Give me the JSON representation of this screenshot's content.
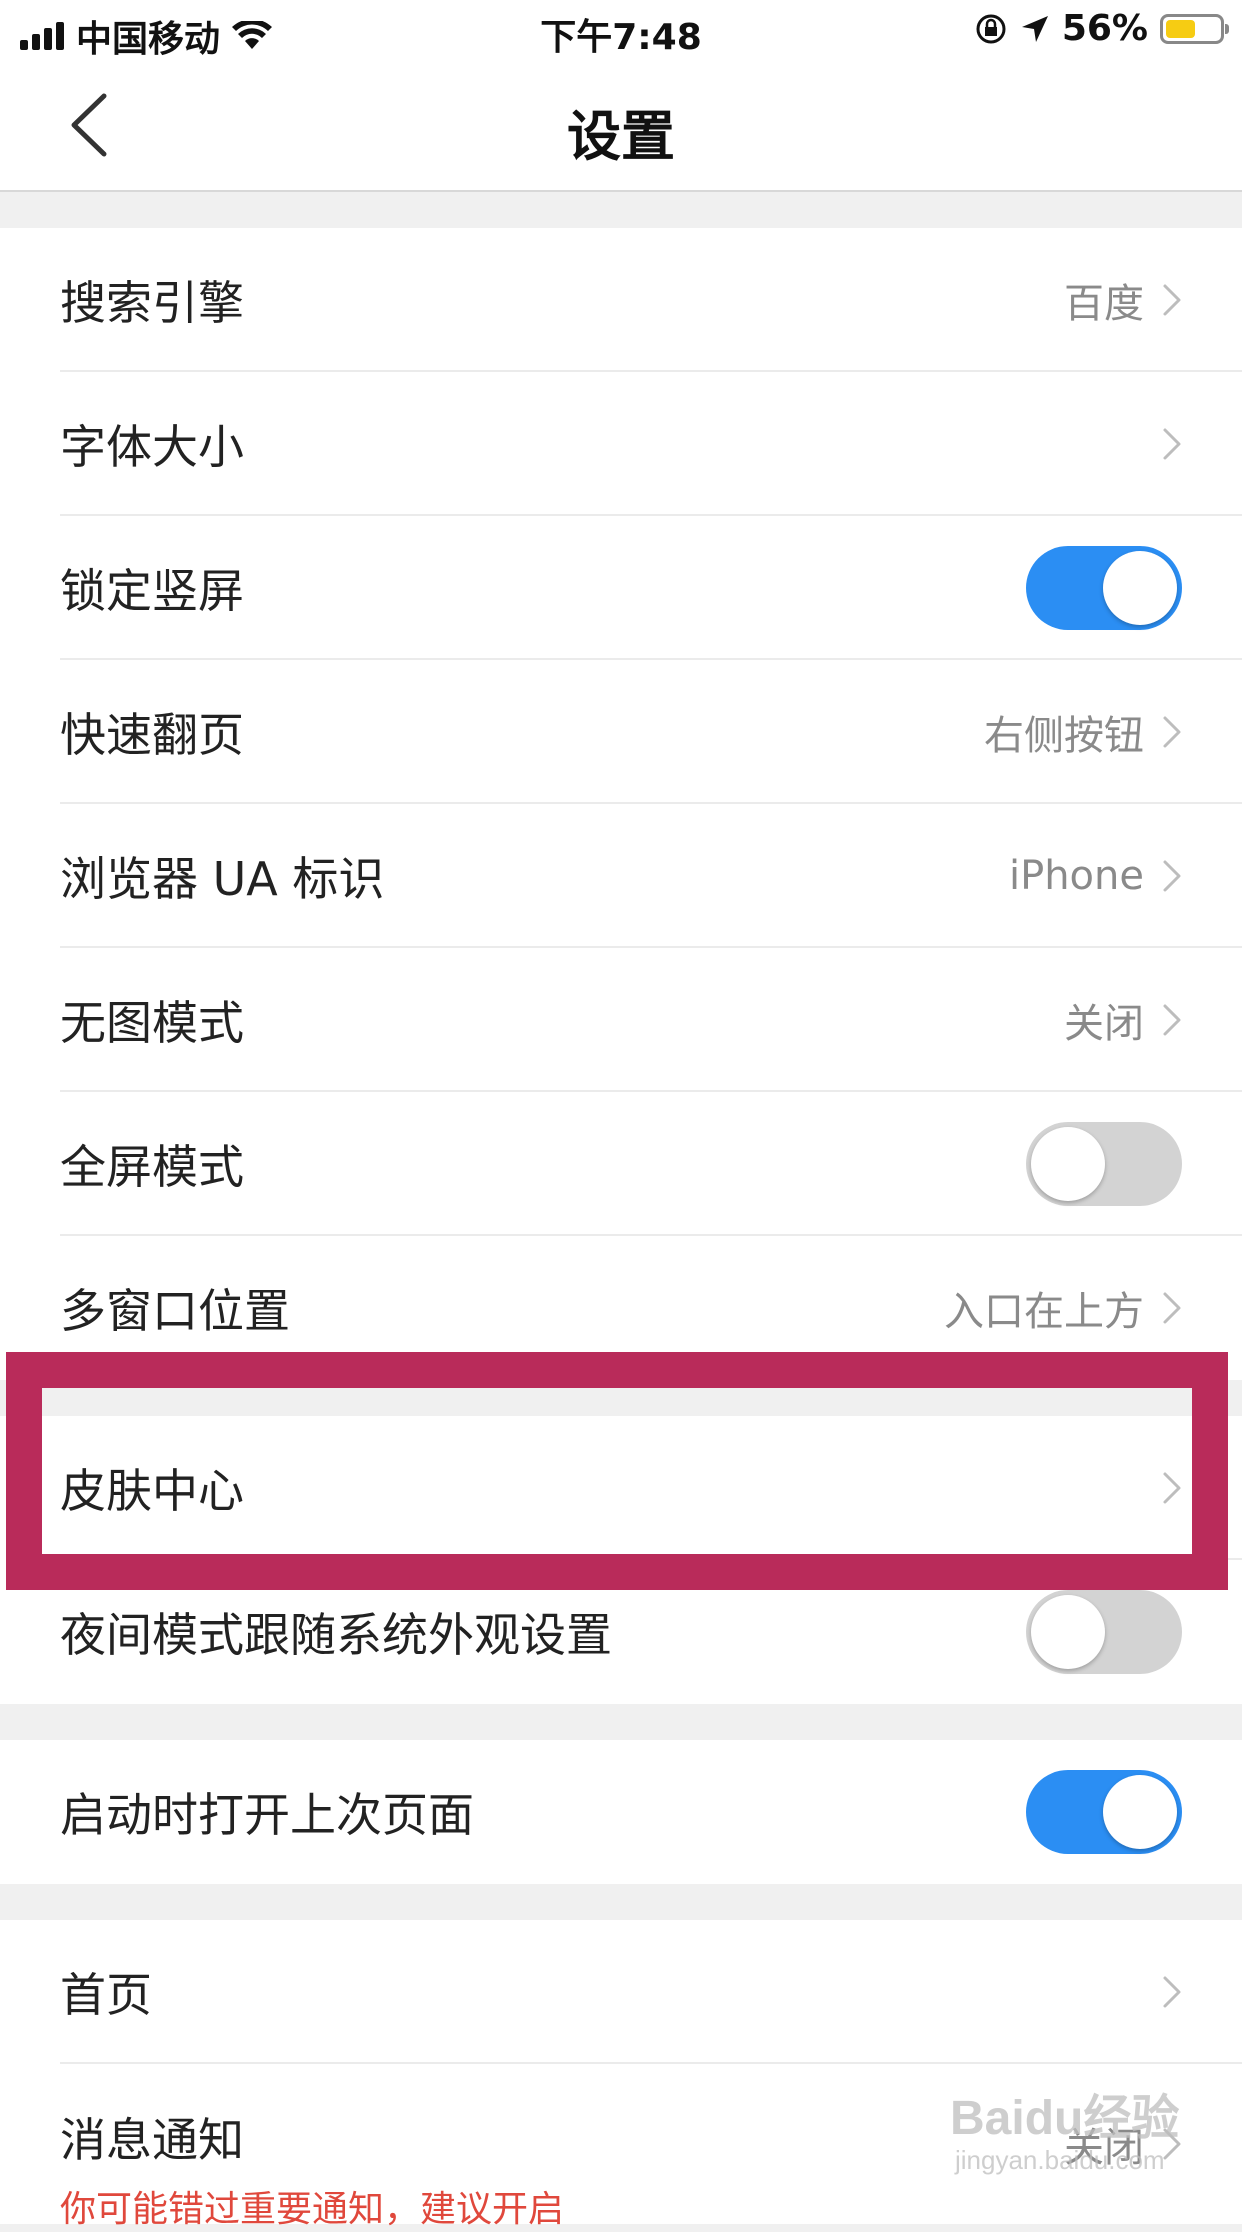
{
  "status_bar": {
    "carrier": "中国移动",
    "time": "下午7:48",
    "battery_percent": "56%",
    "battery_level": 0.56,
    "battery_color": "#f6cc13"
  },
  "nav": {
    "title": "设置",
    "back_icon": "chevron-left-icon"
  },
  "accent_color": "#2b8ef3",
  "highlight_color": "#b92b5a",
  "groups": [
    {
      "rows": [
        {
          "label": "搜索引擎",
          "value": "百度",
          "type": "link"
        },
        {
          "label": "字体大小",
          "value": "",
          "type": "link"
        },
        {
          "label": "锁定竖屏",
          "type": "toggle",
          "on": true
        },
        {
          "label": "快速翻页",
          "value": "右侧按钮",
          "type": "link"
        },
        {
          "label": "浏览器 UA 标识",
          "value": "iPhone",
          "type": "link"
        },
        {
          "label": "无图模式",
          "value": "关闭",
          "type": "link"
        },
        {
          "label": "全屏模式",
          "type": "toggle",
          "on": false
        },
        {
          "label": "多窗口位置",
          "value": "入口在上方",
          "type": "link"
        }
      ]
    },
    {
      "rows": [
        {
          "label": "皮肤中心",
          "value": "",
          "type": "link",
          "highlighted": true
        },
        {
          "label": "夜间模式跟随系统外观设置",
          "type": "toggle",
          "on": false
        }
      ]
    },
    {
      "rows": [
        {
          "label": "启动时打开上次页面",
          "type": "toggle",
          "on": true
        }
      ]
    },
    {
      "rows": [
        {
          "label": "首页",
          "value": "",
          "type": "link"
        },
        {
          "label": "消息通知",
          "value": "关闭",
          "type": "link"
        }
      ]
    }
  ],
  "notification_hint": "你可能错过重要通知，建议开启",
  "watermark": {
    "brand": "Baidu经验",
    "url": "jingyan.baidu.com"
  }
}
